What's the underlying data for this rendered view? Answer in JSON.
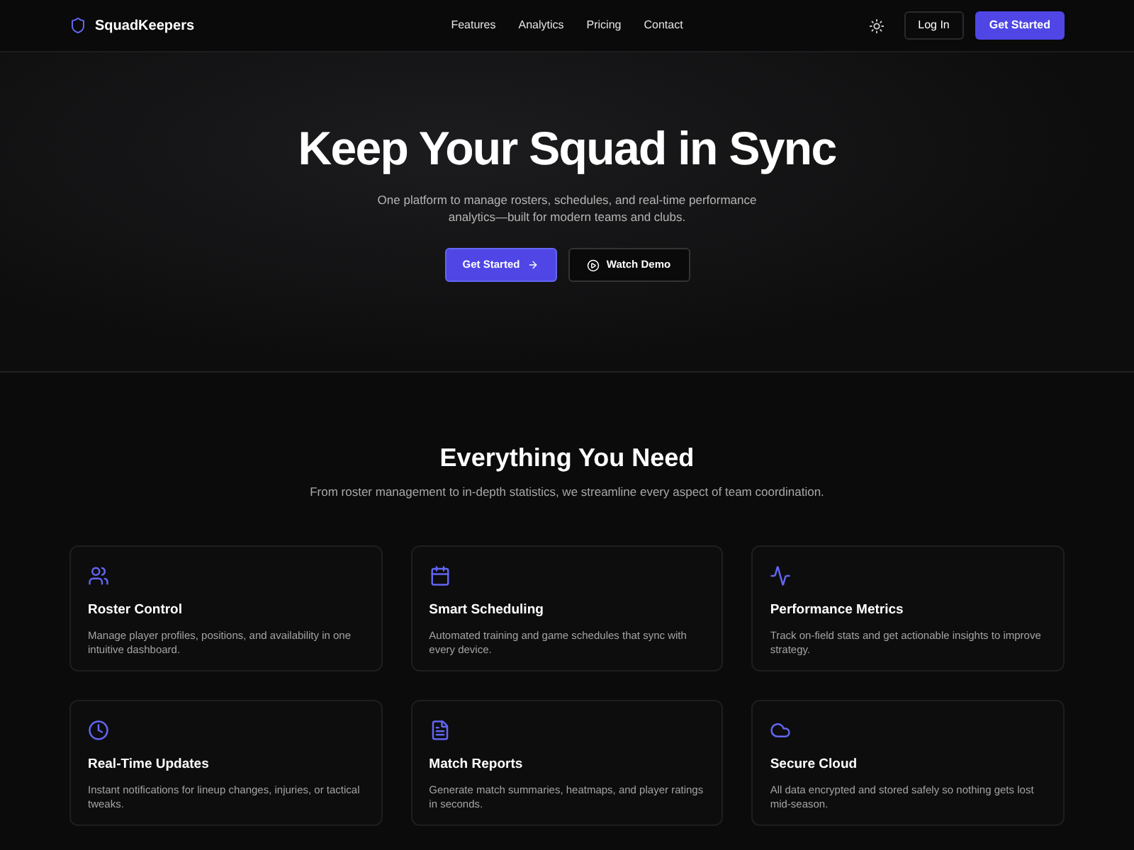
{
  "nav": {
    "brand": "SquadKeepers",
    "links": [
      "Features",
      "Analytics",
      "Pricing",
      "Contact"
    ],
    "login": "Log In",
    "cta": "Get Started"
  },
  "hero": {
    "title": "Keep Your Squad in Sync",
    "subtitle": "One platform to manage rosters, schedules, and real-time performance analytics—built for modern teams and clubs.",
    "primary": "Get Started",
    "secondary": "Watch Demo"
  },
  "features": {
    "title": "Everything You Need",
    "subtitle": "From roster management to in-depth statistics, we streamline every aspect of team coordination.",
    "cards": [
      {
        "kind": "users",
        "title": "Roster Control",
        "text": "Manage player profiles, positions, and availability in one intuitive dashboard."
      },
      {
        "kind": "calendar",
        "title": "Smart Scheduling",
        "text": "Automated training and game schedules that sync with every device."
      },
      {
        "kind": "pulse",
        "title": "Performance Metrics",
        "text": "Track on-field stats and get actionable insights to improve strategy."
      },
      {
        "kind": "clock",
        "title": "Real-Time Updates",
        "text": "Instant notifications for lineup changes, injuries, or tactical tweaks."
      },
      {
        "kind": "document",
        "title": "Match Reports",
        "text": "Generate match summaries, heatmaps, and player ratings in seconds."
      },
      {
        "kind": "cloud",
        "title": "Secure Cloud",
        "text": "All data encrypted and stored safely so nothing gets lost mid-season."
      }
    ]
  }
}
